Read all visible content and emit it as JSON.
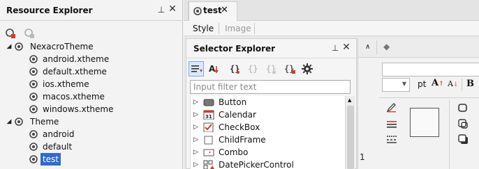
{
  "resource_explorer": {
    "title": "Resource Explorer",
    "tree": [
      {
        "label": "NexacroTheme",
        "children": [
          "android.xtheme",
          "default.xtheme",
          "ios.xtheme",
          "macos.xtheme",
          "windows.xtheme"
        ]
      },
      {
        "label": "Theme",
        "children": [
          "android",
          "default",
          "test"
        ]
      }
    ]
  },
  "editor": {
    "tab_label": "test",
    "subtabs": [
      "Style",
      "Image"
    ]
  },
  "selector_explorer": {
    "title": "Selector Explorer",
    "filter_placeholder": "Input filter text",
    "items": [
      "Button",
      "Calendar",
      "CheckBox",
      "ChildFrame",
      "Combo",
      "DatePickerControl"
    ]
  },
  "props": {
    "font_unit": "pt",
    "line_number": "1"
  },
  "colors": {
    "selected_bg": "#2f6bd3"
  }
}
